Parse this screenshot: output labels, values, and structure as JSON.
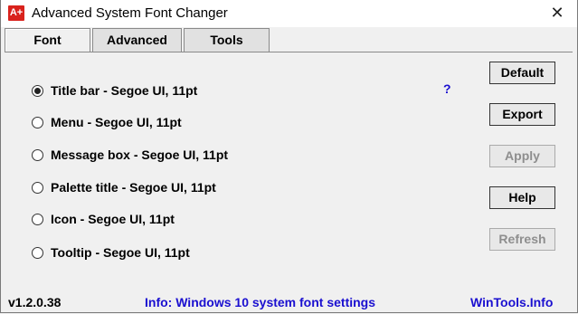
{
  "window": {
    "title": "Advanced System Font Changer",
    "icon_text": "A+",
    "close_glyph": "✕"
  },
  "tabs": [
    {
      "label": "Font",
      "active": true
    },
    {
      "label": "Advanced",
      "active": false
    },
    {
      "label": "Tools",
      "active": false
    }
  ],
  "options": [
    {
      "label": "Title bar - Segoe UI, 11pt",
      "selected": true
    },
    {
      "label": "Menu - Segoe UI, 11pt",
      "selected": false
    },
    {
      "label": "Message box - Segoe UI, 11pt",
      "selected": false
    },
    {
      "label": "Palette title - Segoe UI, 11pt",
      "selected": false
    },
    {
      "label": "Icon - Segoe UI, 11pt",
      "selected": false
    },
    {
      "label": "Tooltip - Segoe UI, 11pt",
      "selected": false
    }
  ],
  "help_link": "?",
  "buttons": {
    "default": {
      "label": "Default",
      "enabled": true
    },
    "export": {
      "label": "Export",
      "enabled": true
    },
    "apply": {
      "label": "Apply",
      "enabled": false
    },
    "help": {
      "label": "Help",
      "enabled": true
    },
    "refresh": {
      "label": "Refresh",
      "enabled": false
    }
  },
  "footer": {
    "version": "v1.2.0.38",
    "info": "Info: Windows 10 system font settings",
    "site": "WinTools.Info"
  },
  "colors": {
    "link": "#1a0fd0",
    "icon_red": "#d9221c",
    "disabled_text": "#8e8e8e"
  }
}
